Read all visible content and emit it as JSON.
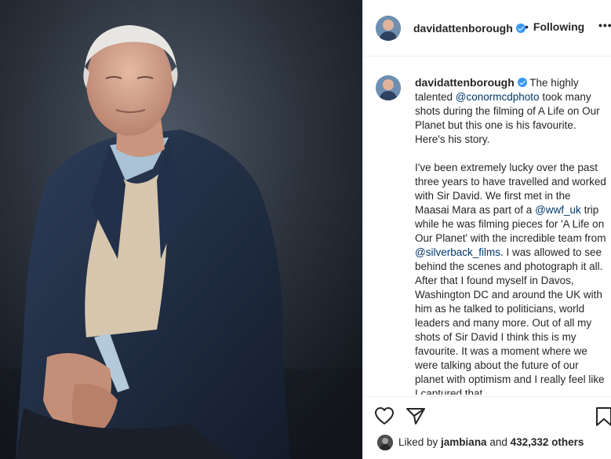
{
  "post": {
    "username": "davidattenborough",
    "follow_status": "Following",
    "separator": "•",
    "more_label": "•••"
  },
  "caption": {
    "username": "davidattenborough",
    "p1_a": "The highly talented ",
    "mention_1": "@conormcdphoto",
    "p1_b": " took many shots during the filming of A Life on Our Planet but this one is his favourite. Here's his story.",
    "p2_a": "I've been extremely lucky over the past three years to have travelled and worked with Sir David. We first met in the Maasai Mara as part of a ",
    "mention_2": "@wwf_uk",
    "p2_b": " trip while he was filming pieces for 'A Life on Our Planet' with the incredible team from ",
    "mention_3": "@silverback_films",
    "p2_c": ". I was allowed to see behind the scenes and photograph it all. After that I found myself in Davos, Washington DC and around the UK with him as he talked to politicians, world leaders and many more. Out of all my shots of Sir David I think this is my favourite. It was a moment where we were talking about the future of our planet with optimism and I really feel like I captured that."
  },
  "likes": {
    "prefix": "Liked by ",
    "user": "jambiana",
    "middle": " and ",
    "count": "432,332 others"
  },
  "icons": {
    "like": "heart-icon",
    "share": "paper-plane-icon",
    "save": "bookmark-icon",
    "verified": "verified-badge-icon",
    "more": "more-options-icon"
  },
  "colors": {
    "verified": "#3897f0",
    "mention": "#00376b",
    "text": "#262626"
  }
}
